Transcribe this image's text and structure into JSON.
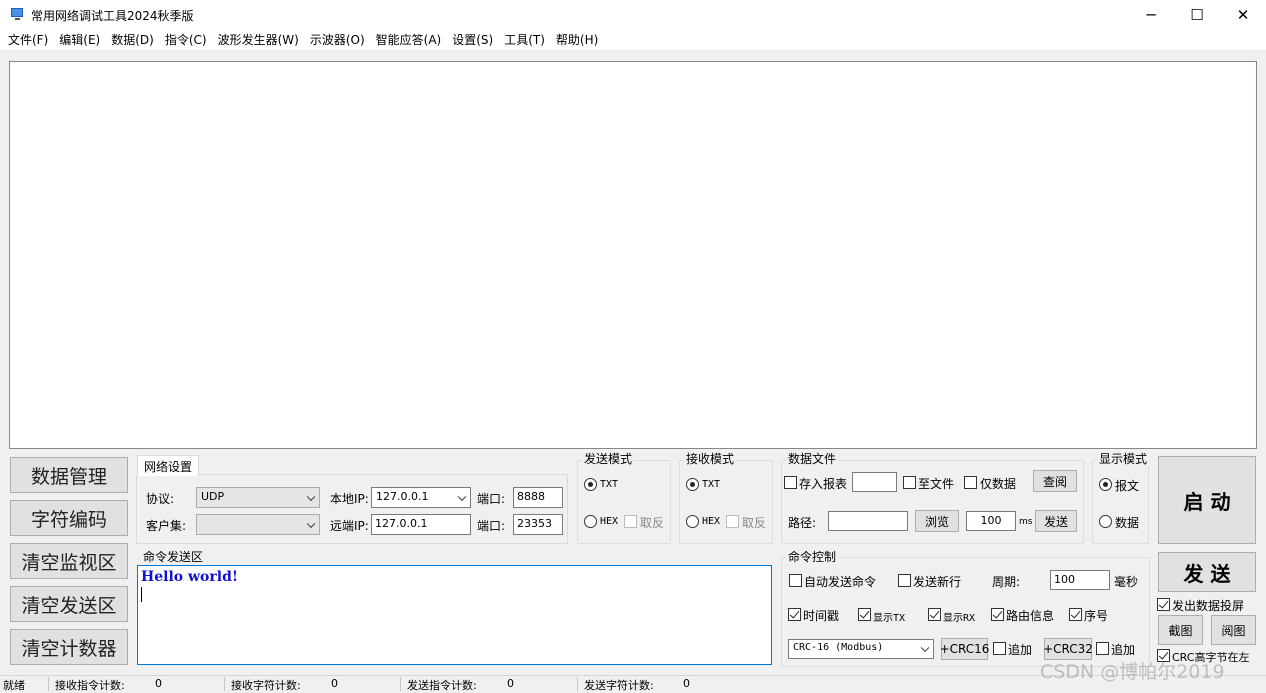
{
  "window": {
    "title": "常用网络调试工具2024秋季版",
    "minimize": "─",
    "maximize": "☐",
    "close": "✕"
  },
  "menu": [
    "文件(F)",
    "编辑(E)",
    "数据(D)",
    "指令(C)",
    "波形发生器(W)",
    "示波器(O)",
    "智能应答(A)",
    "设置(S)",
    "工具(T)",
    "帮助(H)"
  ],
  "left_buttons": [
    "数据管理",
    "字符编码",
    "清空监视区",
    "清空发送区",
    "清空计数器"
  ],
  "network": {
    "tab": "网络设置",
    "protocol_label": "协议:",
    "protocol_value": "UDP",
    "client_label": "客户集:",
    "client_value": "",
    "local_ip_label": "本地IP:",
    "local_ip": "127.0.0.1",
    "remote_ip_label": "远端IP:",
    "remote_ip": "127.0.0.1",
    "port_label": "端口:",
    "local_port": "8888",
    "remote_port": "23353"
  },
  "send_mode": {
    "title": "发送模式",
    "txt": "TXT",
    "hex": "HEX",
    "invert": "取反"
  },
  "recv_mode": {
    "title": "接收模式",
    "txt": "TXT",
    "hex": "HEX",
    "invert": "取反"
  },
  "data_file": {
    "title": "数据文件",
    "save_report": "存入报表",
    "to_file": "至文件",
    "data_only": "仅数据",
    "query": "查阅",
    "path_label": "路径:",
    "browse": "浏览",
    "interval": "100",
    "unit": "ms",
    "send": "发送"
  },
  "display_mode": {
    "title": "显示模式",
    "message": "报文",
    "data": "数据"
  },
  "command_send": {
    "title": "命令发送区",
    "text": "Hello world!"
  },
  "command_control": {
    "title": "命令控制",
    "auto_send": "自动发送命令",
    "send_newline": "发送新行",
    "period_label": "周期:",
    "period_value": "100",
    "period_unit": "毫秒",
    "timestamp": "时间戳",
    "show_tx": "显示TX",
    "show_rx": "显示RX",
    "route_info": "路由信息",
    "seq": "序号",
    "crc_type": "CRC-16 (Modbus)",
    "crc16": "+CRC16",
    "append1": "追加",
    "crc32": "+CRC32",
    "append2": "追加"
  },
  "right_panel": {
    "start": "启 动",
    "send": "发 送",
    "project": "发出数据投屏",
    "screenshot": "截图",
    "view": "阅图",
    "crc_high": "CRC高字节在左"
  },
  "status": {
    "ready": "就绪",
    "recv_cmd_label": "接收指令计数:",
    "recv_cmd": "0",
    "recv_char_label": "接收字符计数:",
    "recv_char": "0",
    "send_cmd_label": "发送指令计数:",
    "send_cmd": "0",
    "send_char_label": "发送字符计数:",
    "send_char": "0"
  },
  "watermark": "CSDN @博帕尔2019"
}
